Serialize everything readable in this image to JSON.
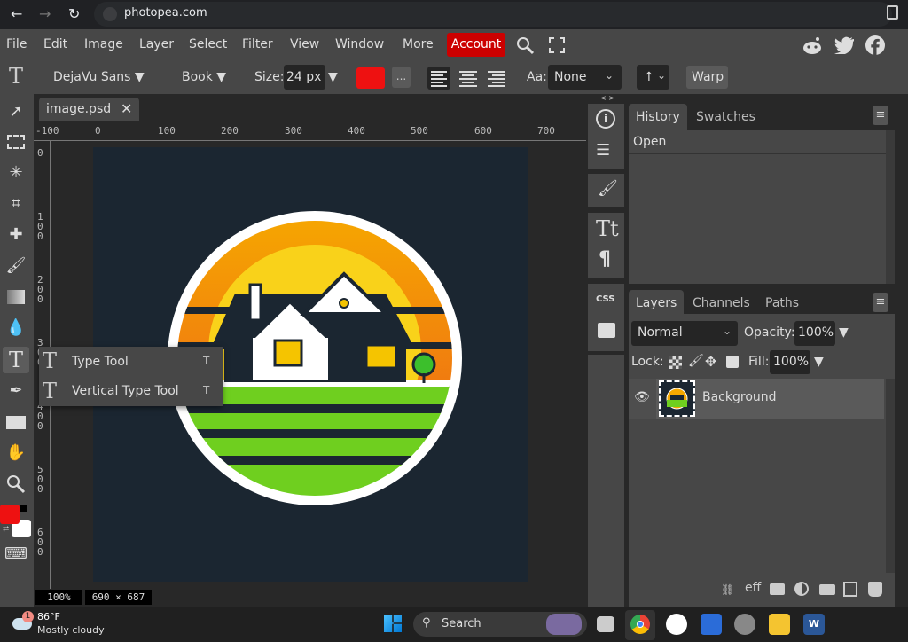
{
  "browser": {
    "url": "photopea.com",
    "icons": [
      "back-arrow-icon",
      "forward-arrow-icon",
      "reload-icon",
      "site-settings-icon",
      "clipboard-icon"
    ]
  },
  "menu": {
    "items": [
      "File",
      "Edit",
      "Image",
      "Layer",
      "Select",
      "Filter",
      "View",
      "Window",
      "More"
    ],
    "account_label": "Account",
    "social": [
      "reddit-icon",
      "twitter-icon",
      "facebook-icon"
    ]
  },
  "options": {
    "font_family": "DejaVu Sans ▼",
    "font_style": "Book ▼",
    "size_label": "Size:",
    "size_value": "24 px",
    "size_arrow": "▼",
    "text_color": "#ee1111",
    "more_label": "...",
    "antialias_label": "Aa:",
    "antialias_value": "None",
    "orientation_value": "↑",
    "warp_label": "Warp"
  },
  "document": {
    "tab_name": "image.psd",
    "ruler_h": [
      "-100",
      "0",
      "100",
      "200",
      "300",
      "400",
      "500",
      "600",
      "700"
    ],
    "ruler_v": [
      "0",
      "100",
      "200",
      "300",
      "400",
      "500",
      "600"
    ],
    "zoom": "100%",
    "dimensions": "690 × 687"
  },
  "tools": {
    "foreground_color": "#ee1111",
    "background_color": "#ffffff"
  },
  "flyout": {
    "items": [
      {
        "label": "Type Tool",
        "shortcut": "T"
      },
      {
        "label": "Vertical Type Tool",
        "shortcut": "T"
      }
    ]
  },
  "history_panel": {
    "tabs": [
      "History",
      "Swatches"
    ],
    "items": [
      "Open"
    ]
  },
  "layers_panel": {
    "tabs": [
      "Layers",
      "Channels",
      "Paths"
    ],
    "blend_mode": "Normal",
    "opacity_label": "Opacity:",
    "opacity_value": "100%",
    "lock_label": "Lock:",
    "fill_label": "Fill:",
    "fill_value": "100%",
    "layers": [
      {
        "name": "Background",
        "visible": true
      }
    ]
  },
  "taskbar": {
    "weather_temp": "86°F",
    "weather_desc": "Mostly cloudy",
    "weather_badge": "1",
    "search_label": "Search"
  }
}
